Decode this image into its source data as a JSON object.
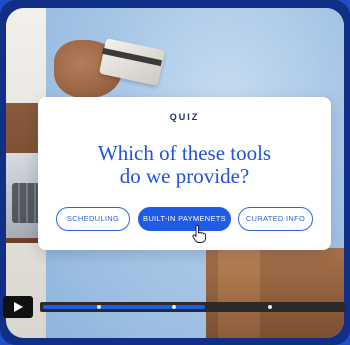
{
  "quiz": {
    "label": "QUIZ",
    "question_line1": "Which of these tools",
    "question_line2": "do we provide?",
    "options": [
      {
        "label": "SCHEDULING",
        "selected": false
      },
      {
        "label": "BUILT-IN PAYMENETS",
        "selected": true
      },
      {
        "label": "CURATED INFO",
        "selected": false
      }
    ]
  },
  "player": {
    "play_icon": "play-icon",
    "progress_percent": 54,
    "chapter_markers_percent": [
      18,
      43,
      75
    ]
  },
  "colors": {
    "accent": "#1f5ae8",
    "question_text": "#2152d8",
    "frame": "#1e4fc8"
  }
}
